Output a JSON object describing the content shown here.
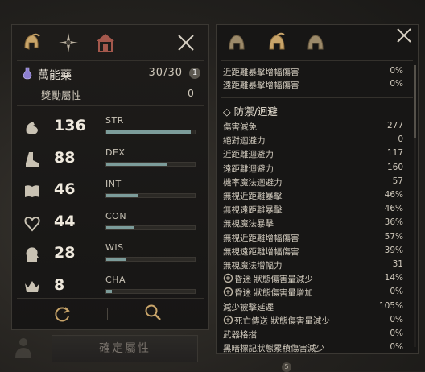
{
  "left_panel": {
    "elixir": {
      "name": "萬能藥",
      "value": "30/30",
      "badge": "1"
    },
    "bonus": {
      "label": "獎勵屬性",
      "value": "0"
    },
    "stats": [
      {
        "key": "str",
        "value": "136",
        "abbr": "STR",
        "fill": 0.95,
        "icon": "arm-icon"
      },
      {
        "key": "dex",
        "value": "88",
        "abbr": "DEX",
        "fill": 0.68,
        "icon": "boot-icon"
      },
      {
        "key": "int",
        "value": "46",
        "abbr": "INT",
        "fill": 0.35,
        "icon": "book-icon"
      },
      {
        "key": "con",
        "value": "44",
        "abbr": "CON",
        "fill": 0.32,
        "icon": "heart-icon"
      },
      {
        "key": "wis",
        "value": "28",
        "abbr": "WIS",
        "fill": 0.22,
        "icon": "head-icon"
      },
      {
        "key": "cha",
        "value": "8",
        "abbr": "CHA",
        "fill": 0.06,
        "icon": "crown-icon"
      }
    ],
    "confirm_label": "確定屬性"
  },
  "right_panel": {
    "top_rows": [
      {
        "label": "近距離暴擊增幅傷害",
        "value": "0%"
      },
      {
        "label": "遠距離暴擊增幅傷害",
        "value": "0%"
      }
    ],
    "section_title": "◇ 防禦/迴避",
    "rows": [
      {
        "label": "傷害減免",
        "value": "277"
      },
      {
        "label": "絕對迴避力",
        "value": "0"
      },
      {
        "label": "近距離迴避力",
        "value": "117"
      },
      {
        "label": "遠距離迴避力",
        "value": "160"
      },
      {
        "label": "機率魔法迴避力",
        "value": "57"
      },
      {
        "label": "無視近距離暴擊",
        "value": "46%"
      },
      {
        "label": "無視遠距離暴擊",
        "value": "46%"
      },
      {
        "label": "無視魔法暴擊",
        "value": "36%"
      },
      {
        "label": "無視近距離增幅傷害",
        "value": "57%"
      },
      {
        "label": "無視遠距離增幅傷害",
        "value": "39%"
      },
      {
        "label": "無視魔法增幅力",
        "value": "31"
      },
      {
        "label": "昏迷 狀態傷害量減少",
        "value": "14%",
        "icon": true
      },
      {
        "label": "昏迷 狀態傷害量增加",
        "value": "0%",
        "icon": true
      },
      {
        "label": "減少被擊延遲",
        "value": "105%"
      },
      {
        "label": "死亡傳送 狀態傷害量減少",
        "value": "0%",
        "icon": true
      },
      {
        "label": "武器格擋",
        "value": "0%"
      },
      {
        "label": "黑暗標記狀態累積傷害減少",
        "value": "0%"
      }
    ],
    "bottom_badge": "5"
  },
  "colors": {
    "gold": "#c9a56a",
    "bar": "#7c9c9a",
    "panel": "#171615"
  }
}
